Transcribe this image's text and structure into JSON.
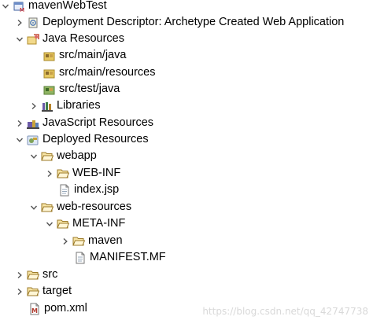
{
  "tree": {
    "root": "mavenWebTest",
    "deployment_descriptor": "Deployment Descriptor: Archetype Created Web Application",
    "java_resources": "Java Resources",
    "src_main_java": "src/main/java",
    "src_main_resources": "src/main/resources",
    "src_test_java": "src/test/java",
    "libraries": "Libraries",
    "javascript_resources": "JavaScript Resources",
    "deployed_resources": "Deployed Resources",
    "webapp": "webapp",
    "web_inf": "WEB-INF",
    "index_jsp": "index.jsp",
    "web_resources": "web-resources",
    "meta_inf": "META-INF",
    "maven": "maven",
    "manifest_mf": "MANIFEST.MF",
    "src": "src",
    "target": "target",
    "pom_xml": "pom.xml"
  },
  "watermark": "https://blog.csdn.net/qq_42747738",
  "icons": {
    "project": "maven-web-project-icon",
    "deployment_descriptor": "deployment-descriptor-icon",
    "java_resources": "java-resources-icon",
    "source_folder": "package-folder-icon",
    "test_folder": "test-package-folder-icon",
    "libraries": "libraries-icon",
    "javascript_resources": "javascript-resources-icon",
    "deployed_resources": "deployed-resources-icon",
    "folder": "folder-icon",
    "file": "file-icon",
    "xml_file": "xml-file-icon"
  }
}
